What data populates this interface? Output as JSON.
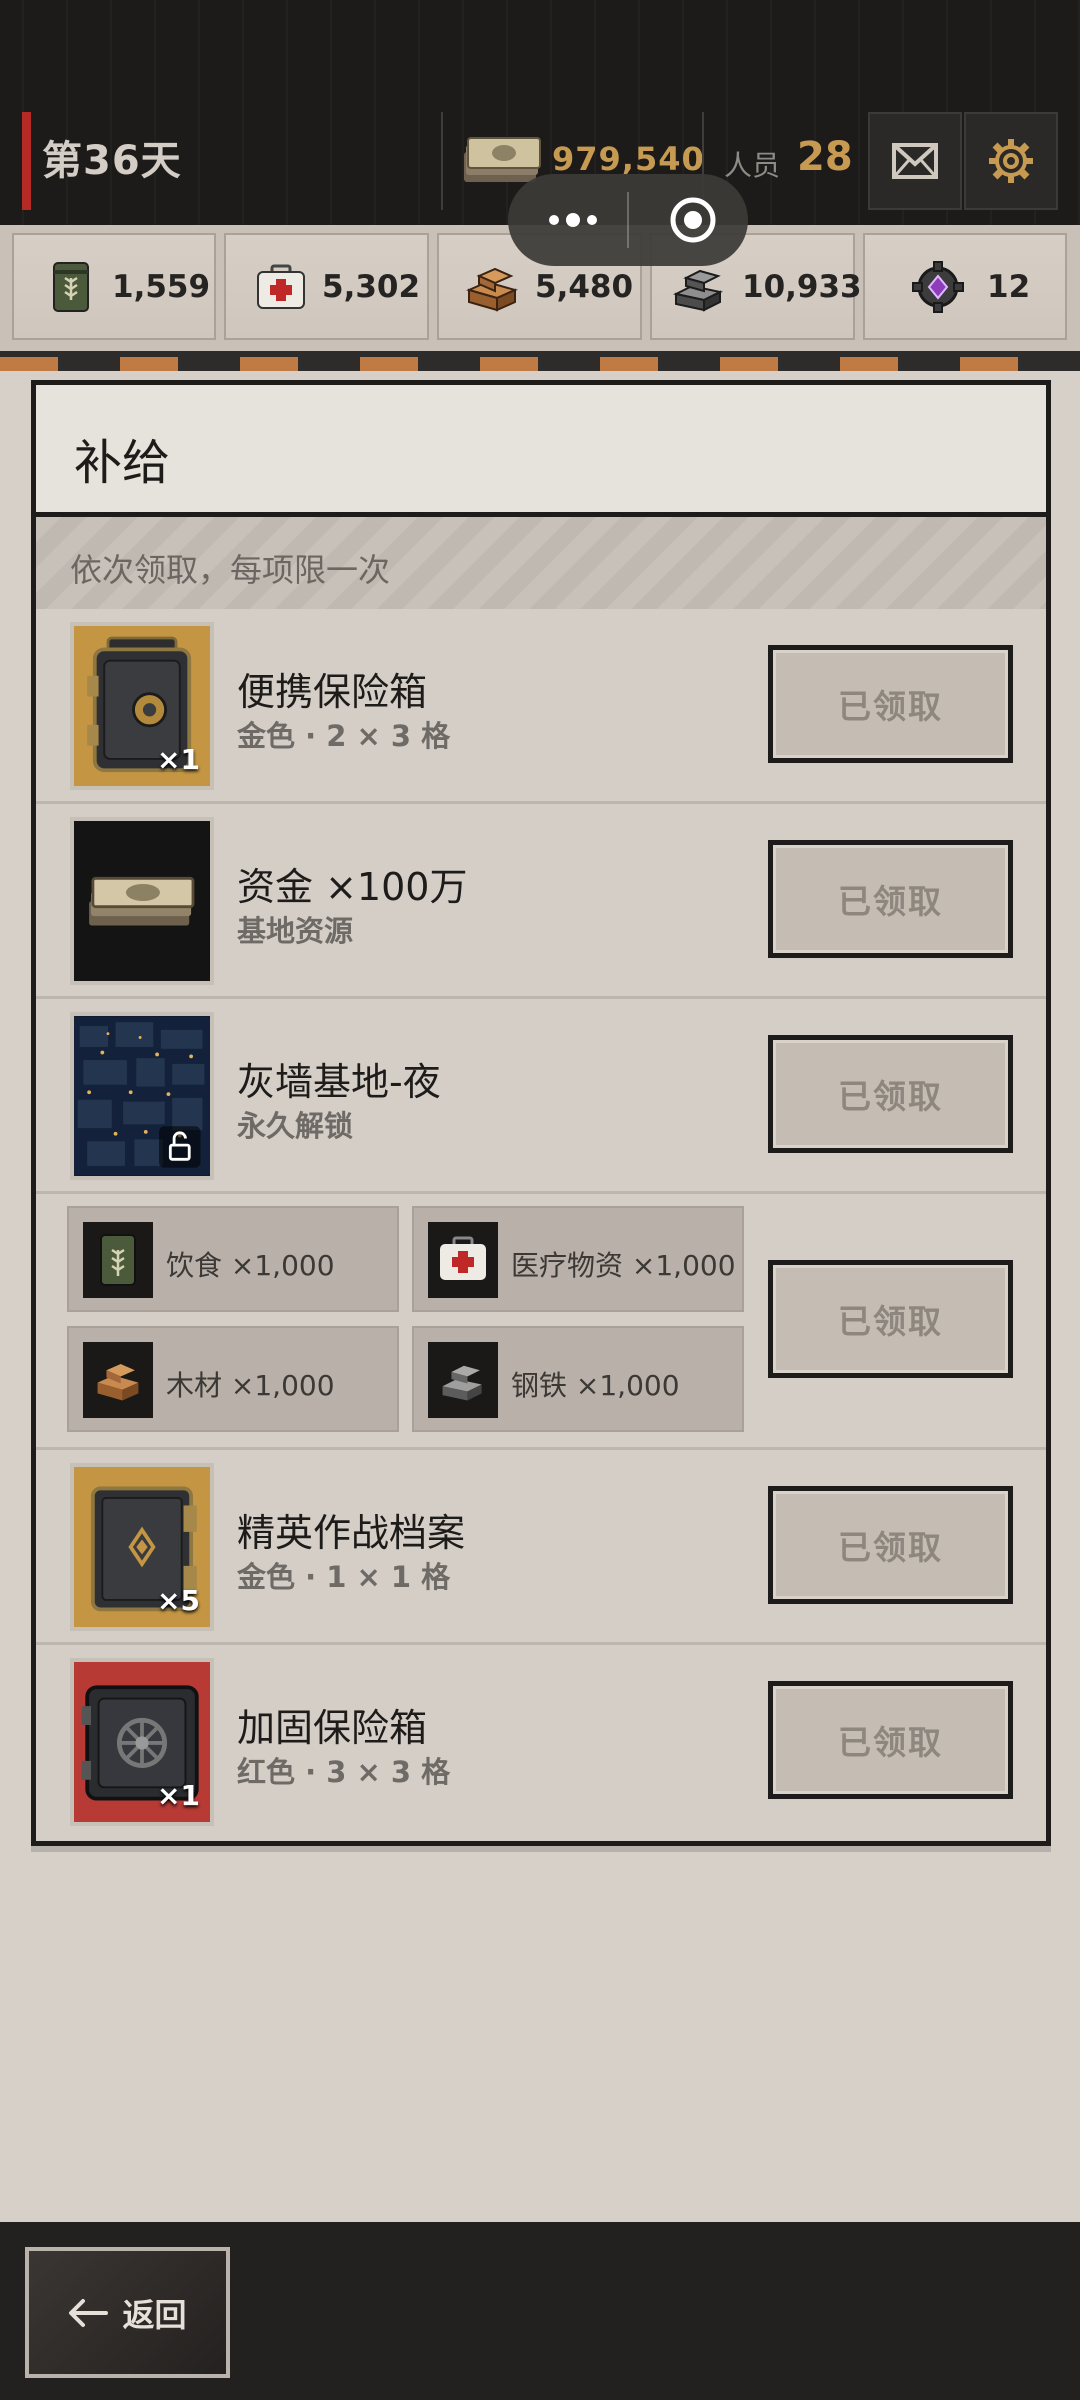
{
  "header": {
    "day_label": "第36天",
    "money_value": "979,540",
    "people_label": "人员",
    "people_value": "28"
  },
  "resources": [
    {
      "icon": "food-can-icon",
      "value": "1,559"
    },
    {
      "icon": "medkit-icon",
      "value": "5,302"
    },
    {
      "icon": "wood-planks-icon",
      "value": "5,480"
    },
    {
      "icon": "steel-ingots-icon",
      "value": "10,933"
    },
    {
      "icon": "gear-gem-icon",
      "value": "12"
    }
  ],
  "panel": {
    "title": "补给",
    "subtitle": "依次领取，每项限一次",
    "claim_label": "已领取",
    "items": [
      {
        "name": "便携保险箱",
        "sub": "金色 · 2 × 3 格",
        "qty": "×1",
        "icon": "portable-safe-icon"
      },
      {
        "name": "资金 ×100万",
        "sub": "基地资源",
        "qty": "",
        "icon": "cash-stack-icon"
      },
      {
        "name": "灰墙基地-夜",
        "sub": "永久解锁",
        "qty": "",
        "icon": "night-base-image"
      },
      {
        "name": "精英作战档案",
        "sub": "金色 · 1 × 1 格",
        "qty": "×5",
        "icon": "elite-case-icon"
      },
      {
        "name": "加固保险箱",
        "sub": "红色 · 3 × 3 格",
        "qty": "×1",
        "icon": "reinforced-safe-icon"
      }
    ],
    "bundle": [
      {
        "label": "饮食 ×1,000",
        "icon": "food-can-icon"
      },
      {
        "label": "医疗物资 ×1,000",
        "icon": "medkit-icon"
      },
      {
        "label": "木材 ×1,000",
        "icon": "wood-planks-icon"
      },
      {
        "label": "钢铁 ×1,000",
        "icon": "steel-ingots-icon"
      }
    ]
  },
  "footer": {
    "back_label": "返回"
  },
  "colors": {
    "accent_gold": "#c79a52",
    "accent_red": "#b52a25",
    "panel_bg": "#d4cec7"
  }
}
